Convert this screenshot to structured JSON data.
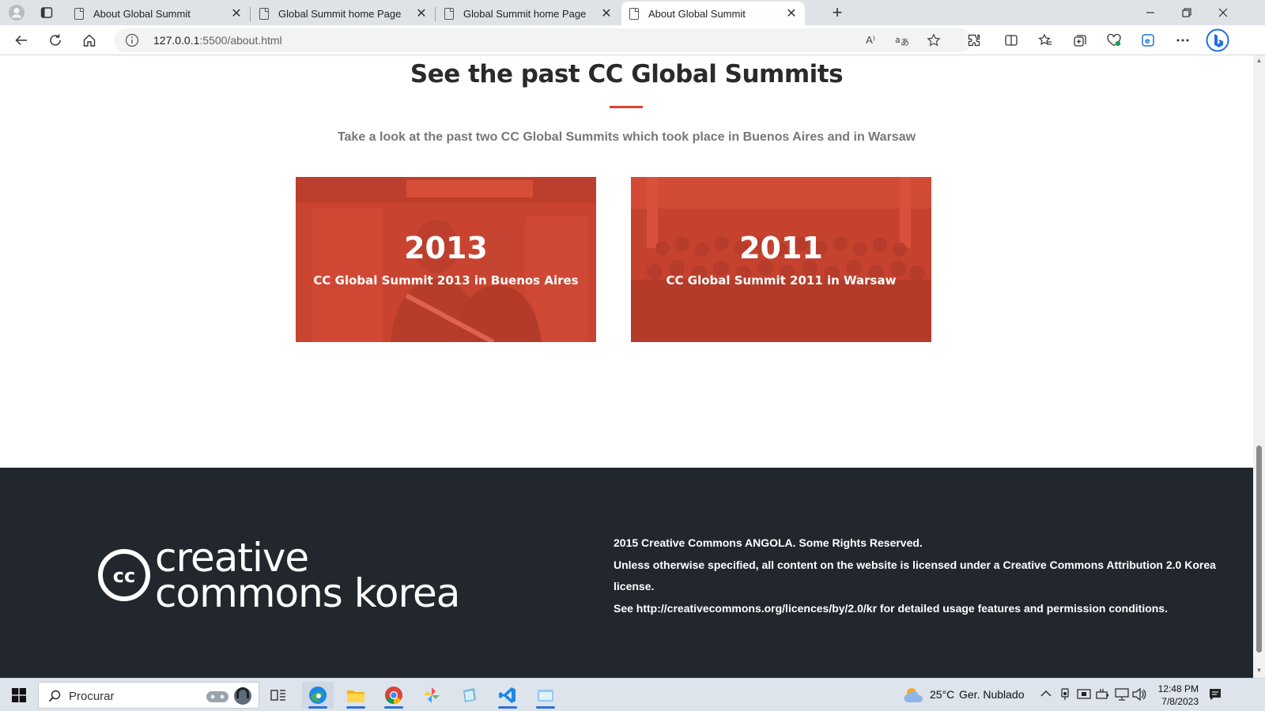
{
  "browser": {
    "tabs": [
      {
        "title": "About Global Summit",
        "active": false
      },
      {
        "title": "Global Summit home Page",
        "active": false
      },
      {
        "title": "Global Summit home Page",
        "active": false
      },
      {
        "title": "About Global Summit",
        "active": true
      }
    ],
    "url_host": "127.0.0.1",
    "url_rest": ":5500/about.html",
    "read_aloud_glyph": "A⁾"
  },
  "page": {
    "section_title": "See the past CC Global Summits",
    "section_subtitle": "Take a look at the past two CC Global Summits which took place in Buenos Aires and in Warsaw",
    "cards": [
      {
        "year": "2013",
        "caption": "CC Global Summit 2013 in Buenos Aires"
      },
      {
        "year": "2011",
        "caption": "CC Global Summit 2011 in Warsaw"
      }
    ],
    "accent_color": "#e3422c",
    "footer": {
      "logo_word1": "creative",
      "logo_word2": "commons korea",
      "logo_cc": "cc",
      "line1": "2015 Creative Commons ANGOLA. Some Rights Reserved.",
      "line2": "Unless otherwise specified, all content on the website is licensed under a Creative Commons Attribution 2.0 Korea license.",
      "line3": "See http://creativecommons.org/licences/by/2.0/kr for detailed usage features and permission conditions.",
      "background": "#22272e"
    }
  },
  "taskbar": {
    "search_placeholder": "Procurar",
    "weather_temp": "25°C",
    "weather_desc": "Ger. Nublado",
    "time": "12:48 PM",
    "date": "7/8/2023"
  }
}
